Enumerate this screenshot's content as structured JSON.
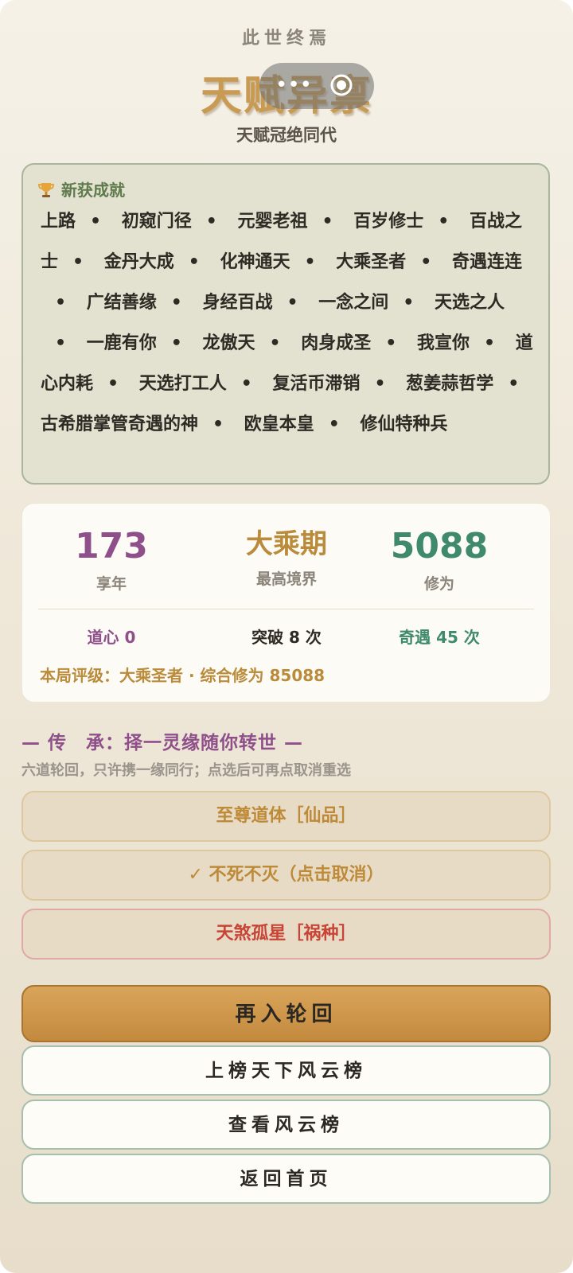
{
  "header": {
    "subtitle": "此世终焉",
    "title": "天赋异禀",
    "rank_label": "天赋冠绝同代"
  },
  "capsule": {
    "menu_icon": "more-dots-icon",
    "close_icon": "target-close-icon",
    "menu_glyph": "•••"
  },
  "achievements": {
    "icon": "trophy-icon",
    "heading": "新获成就",
    "items": [
      "上路",
      "初窥门径",
      "元婴老祖",
      "百岁修士",
      "百战之士",
      "金丹大成",
      "化神通天",
      "大乘圣者",
      "奇遇连连",
      "广结善缘",
      "身经百战",
      "一念之间",
      "天选之人",
      "一鹿有你",
      "龙傲天",
      "肉身成圣",
      "我宣你",
      "道心内耗",
      "天选打工人",
      "复活币滞销",
      "葱姜蒜哲学",
      "古希腊掌管奇遇的神",
      "欧皇本皇",
      "修仙特种兵"
    ],
    "separator": "•"
  },
  "stats": {
    "lifespan": {
      "value": "173",
      "label": "享年",
      "color": "#8e4f8a"
    },
    "realm": {
      "value": "大乘期",
      "label": "最高境界",
      "color": "#b98b3a"
    },
    "cultivation": {
      "value": "5088",
      "label": "修为",
      "color": "#3f8a6c"
    },
    "dao_heart": {
      "text": "道心 0",
      "color": "#8e4f8a"
    },
    "breakthrough": {
      "text": "突破 8 次",
      "color": "#2e2a24"
    },
    "encounters": {
      "text": "奇遇 45 次",
      "color": "#3f8a6c"
    },
    "rating": "本局评级：大乘圣者 · 综合修为 85088"
  },
  "inheritance": {
    "title": "— 传　承：择一灵缘随你转世 —",
    "description": "六道轮回，只许携一缘同行；点选后可再点取消重选",
    "options": [
      {
        "label": "至尊道体［仙品］",
        "style": "gold"
      },
      {
        "label": "✓ 不死不灭（点击取消）",
        "style": "gold"
      },
      {
        "label": "天煞孤星［祸种］",
        "style": "red"
      }
    ]
  },
  "actions": {
    "reincarnate": "再入轮回",
    "submit_ranking": "上榜天下风云榜",
    "view_ranking": "查看风云榜",
    "back_home": "返回首页"
  }
}
